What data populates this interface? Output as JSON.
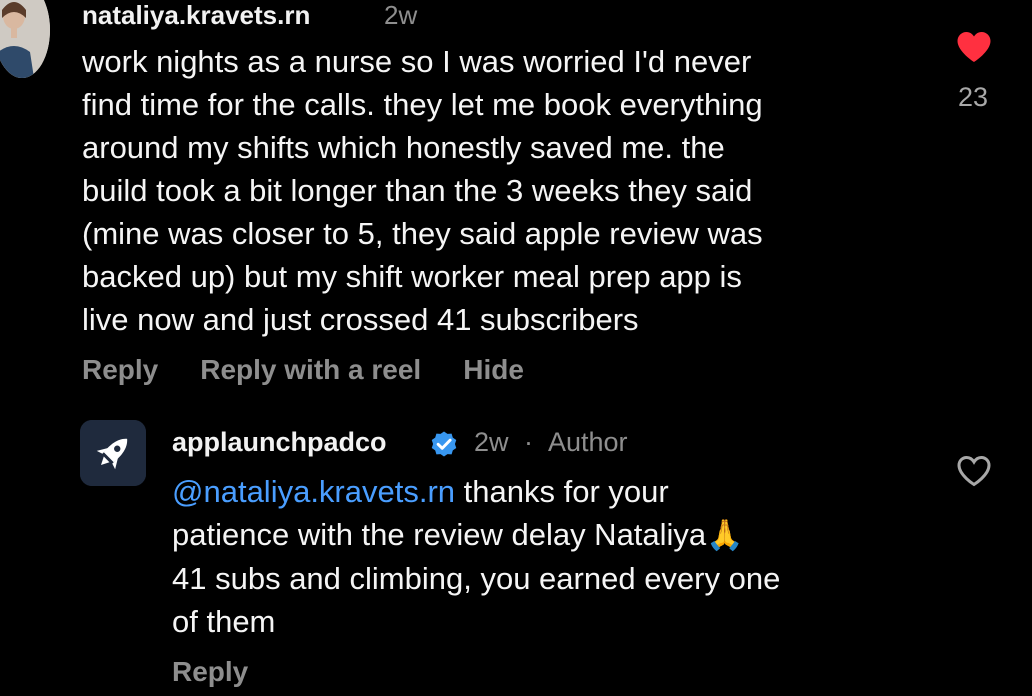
{
  "comment": {
    "username": "nataliya.kravets.rn",
    "time": "2w",
    "text_lines": [
      "work nights as a nurse so I was worried I'd never",
      "find time for the calls. they let me book everything",
      "around my shifts which honestly saved me. the",
      "build took a bit longer than the 3 weeks they said",
      "(mine was closer to 5, they said apple review was",
      "backed up) but my shift worker meal prep app is",
      "live now and just crossed 41 subscribers"
    ],
    "actions": {
      "reply": "Reply",
      "reply_with_reel": "Reply with a reel",
      "hide": "Hide"
    },
    "like_icon": "heart-filled-icon",
    "like_count": "23",
    "like_color": "#ff3040"
  },
  "reply": {
    "username": "applaunchpadco",
    "verified_icon": "verified-badge-icon",
    "time": "2w",
    "separator": "·",
    "author_label": "Author",
    "mention": "@nataliya.kravets.rn",
    "text_line_1_rest": " thanks for your",
    "text_line_2": "patience with the review delay Nataliya",
    "emoji": "🙏",
    "text_line_3": "41 subs and climbing, you earned every one",
    "text_line_4": "of them",
    "actions": {
      "reply": "Reply"
    },
    "like_icon": "heart-outline-icon",
    "avatar_icon": "rocket-icon",
    "mention_color": "#4a9eff"
  }
}
